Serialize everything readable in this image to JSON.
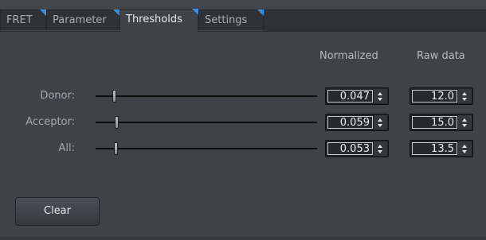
{
  "tabs": [
    {
      "label": "FRET",
      "active": false
    },
    {
      "label": "Parameter",
      "active": false
    },
    {
      "label": "Thresholds",
      "active": true
    },
    {
      "label": "Settings",
      "active": false
    }
  ],
  "columns": {
    "normalized": "Normalized",
    "raw": "Raw data"
  },
  "rows": [
    {
      "label": "Donor:",
      "normalized": "0.047",
      "raw": "12.0",
      "slider_fraction": 0.047
    },
    {
      "label": "Acceptor:",
      "normalized": "0.059",
      "raw": "15.0",
      "slider_fraction": 0.059
    },
    {
      "label": "All:",
      "normalized": "0.053",
      "raw": "13.5",
      "slider_fraction": 0.053
    }
  ],
  "clear_label": "Clear",
  "colors": {
    "tab_corner_accent": "#3c8ede",
    "panel_background": "#3e434a"
  }
}
